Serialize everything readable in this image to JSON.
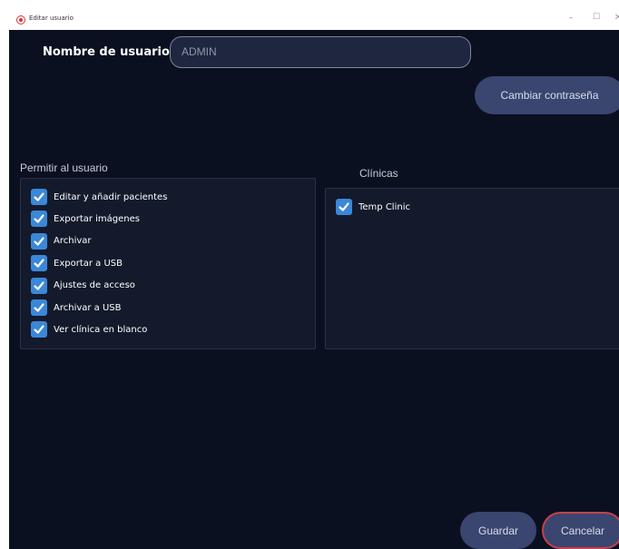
{
  "window": {
    "title": "Editar usuario",
    "controls": {
      "minimize": "–",
      "maximize": "☐",
      "close": "✕"
    }
  },
  "user": {
    "label": "Nombre de usuario",
    "value": "ADMIN"
  },
  "buttons": {
    "change_password": "Cambiar contraseña",
    "save": "Guardar",
    "cancel": "Cancelar"
  },
  "permissions": {
    "label": "Permitir al usuario",
    "items": [
      {
        "label": "Editar y añadir pacientes",
        "checked": true
      },
      {
        "label": "Exportar imágenes",
        "checked": true
      },
      {
        "label": "Archivar",
        "checked": true
      },
      {
        "label": "Exportar a USB",
        "checked": true
      },
      {
        "label": "Ajustes de acceso",
        "checked": true
      },
      {
        "label": "Archivar a USB",
        "checked": true
      },
      {
        "label": "Ver clínica en blanco",
        "checked": true
      }
    ]
  },
  "clinics": {
    "label": "Clínicas",
    "items": [
      {
        "label": "Temp Clinic",
        "checked": true
      }
    ]
  },
  "colors": {
    "background": "#0b1021",
    "panel": "#131a2c",
    "button": "#3a4670",
    "checkbox": "#3b87d8",
    "cancel_border": "#c9404a"
  },
  "icons": {
    "app": "app-logo-icon",
    "checkbox": "checkmark-icon"
  }
}
